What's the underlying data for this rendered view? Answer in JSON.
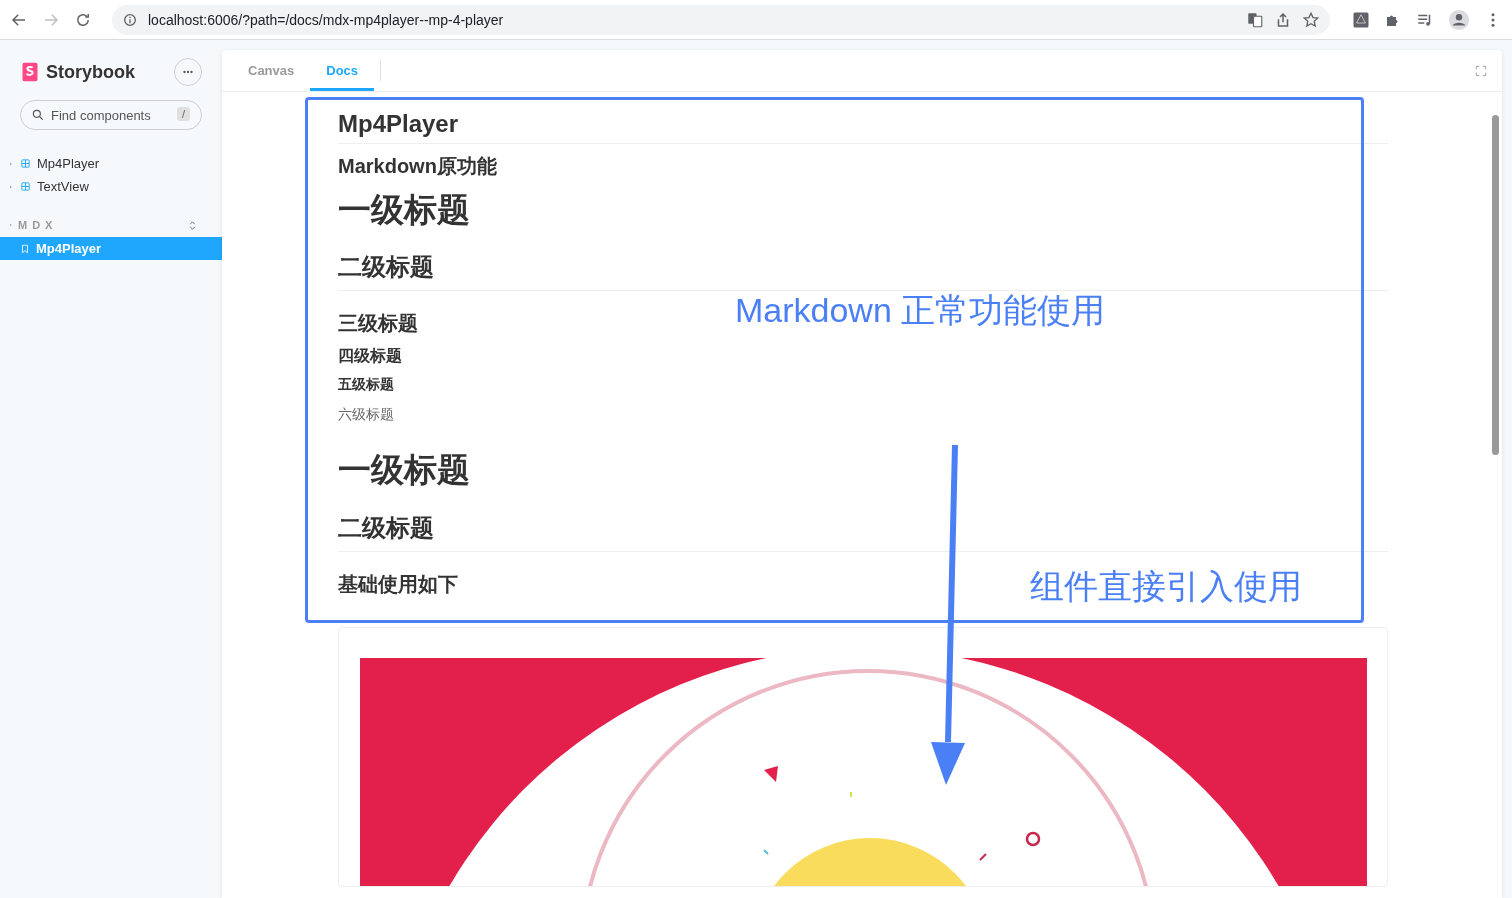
{
  "browser": {
    "url": "localhost:6006/?path=/docs/mdx-mp4player--mp-4-player"
  },
  "sidebar": {
    "brand": "Storybook",
    "search": {
      "placeholder": "Find components",
      "shortcut": "/"
    },
    "items": [
      {
        "label": "Mp4Player",
        "selected": false
      },
      {
        "label": "TextView",
        "selected": false
      }
    ],
    "group": {
      "label": "MDX",
      "items": [
        {
          "label": "Mp4Player",
          "selected": true
        }
      ]
    }
  },
  "tabs": [
    {
      "label": "Canvas",
      "selected": false
    },
    {
      "label": "Docs",
      "selected": true
    }
  ],
  "docs": {
    "blocks": [
      {
        "kind": "h1",
        "text": "Mp4Player"
      },
      {
        "kind": "h3",
        "text": "Markdown原功能"
      },
      {
        "kind": "h1big",
        "text": "一级标题"
      },
      {
        "kind": "h2",
        "text": "二级标题"
      },
      {
        "kind": "h3",
        "text": "三级标题"
      },
      {
        "kind": "h4",
        "text": "四级标题"
      },
      {
        "kind": "h5",
        "text": "五级标题"
      },
      {
        "kind": "h6",
        "text": "六级标题"
      },
      {
        "kind": "h1big",
        "text": "一级标题"
      },
      {
        "kind": "h2",
        "text": "二级标题"
      },
      {
        "kind": "h3",
        "text": "基础使用如下"
      },
      {
        "kind": "picture"
      }
    ]
  },
  "annotations": [
    {
      "text": "Markdown 正常功能使用"
    },
    {
      "text": "组件直接引入使用"
    }
  ]
}
